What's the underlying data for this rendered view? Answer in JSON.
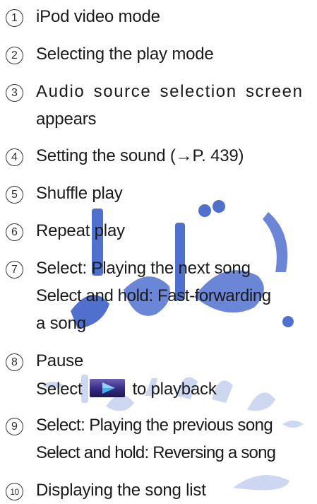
{
  "watermark": {
    "text": "۰۲۱-۸۸۴۶۲۰",
    "colors": {
      "blue": "#3e61c9",
      "light": "#c9d3ef"
    }
  },
  "items": [
    {
      "number": "1",
      "lines": [
        "iPod video mode"
      ]
    },
    {
      "number": "2",
      "lines": [
        "Selecting the play mode"
      ]
    },
    {
      "number": "3",
      "lines": [
        "Audio source selection screen",
        "appears"
      ]
    },
    {
      "number": "4",
      "lines": [
        "Setting the sound (→P. 439)"
      ]
    },
    {
      "number": "5",
      "lines": [
        "Shuffle play"
      ]
    },
    {
      "number": "6",
      "lines": [
        "Repeat play"
      ]
    },
    {
      "number": "7",
      "lines": [
        "Select: Playing the next song",
        "Select and hold: Fast-forwarding",
        "a song"
      ]
    },
    {
      "number": "8",
      "lines": [
        "Pause",
        "Select",
        "to playback"
      ],
      "icon": "play-button-icon"
    },
    {
      "number": "9",
      "lines": [
        "Select: Playing the previous song",
        "Select and hold: Reversing a song"
      ]
    },
    {
      "number": "10",
      "lines": [
        "Displaying the song list"
      ]
    }
  ]
}
